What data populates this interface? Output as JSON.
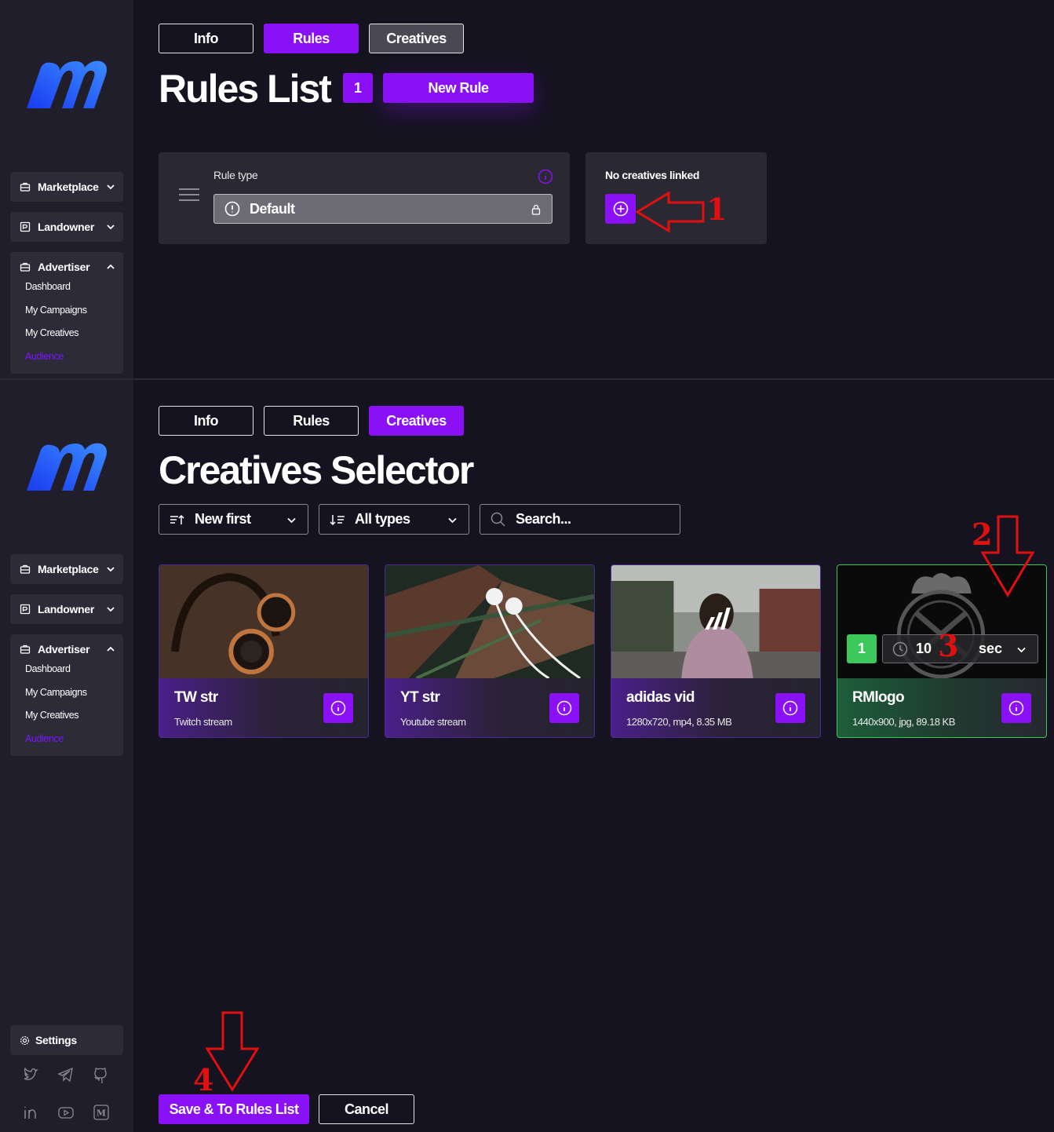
{
  "colors": {
    "accent": "#8a10f5",
    "selected": "#3cc85b",
    "annotation": "#e01010",
    "sidebar": "#201e2b",
    "background": "#15131f"
  },
  "sidebar": {
    "marketplace": "Marketplace",
    "landowner": "Landowner",
    "advertiser": "Advertiser",
    "advertiser_items": [
      "Dashboard",
      "My Campaigns",
      "My Creatives",
      "Audience"
    ],
    "active_item": "Audience",
    "settings": "Settings",
    "social_icons": [
      "twitter-icon",
      "telegram-icon",
      "github-icon",
      "linkedin-icon",
      "youtube-icon",
      "medium-icon"
    ]
  },
  "tabs": [
    "Info",
    "Rules",
    "Creatives"
  ],
  "rules_view": {
    "title": "Rules List",
    "count": "1",
    "new_rule": "New Rule",
    "rule_type_label": "Rule type",
    "rule_type_value": "Default",
    "no_creatives": "No creatives linked"
  },
  "creatives_view": {
    "title": "Creatives Selector",
    "sort": "New first",
    "type_filter": "All types",
    "search_placeholder": "Search..."
  },
  "creatives": [
    {
      "name": "TW str",
      "meta": "Twitch stream"
    },
    {
      "name": "YT str",
      "meta": "Youtube stream"
    },
    {
      "name": "adidas vid",
      "meta": "1280x720, mp4, 8.35 MB"
    },
    {
      "name": "RMlogo",
      "meta": "1440x900, jpg, 89.18 KB",
      "selected": true,
      "order": "1",
      "duration": "10",
      "duration_unit": "sec"
    }
  ],
  "annotations": [
    "1",
    "2",
    "3",
    "4"
  ],
  "footer": {
    "save": "Save & To Rules List",
    "cancel": "Cancel"
  }
}
